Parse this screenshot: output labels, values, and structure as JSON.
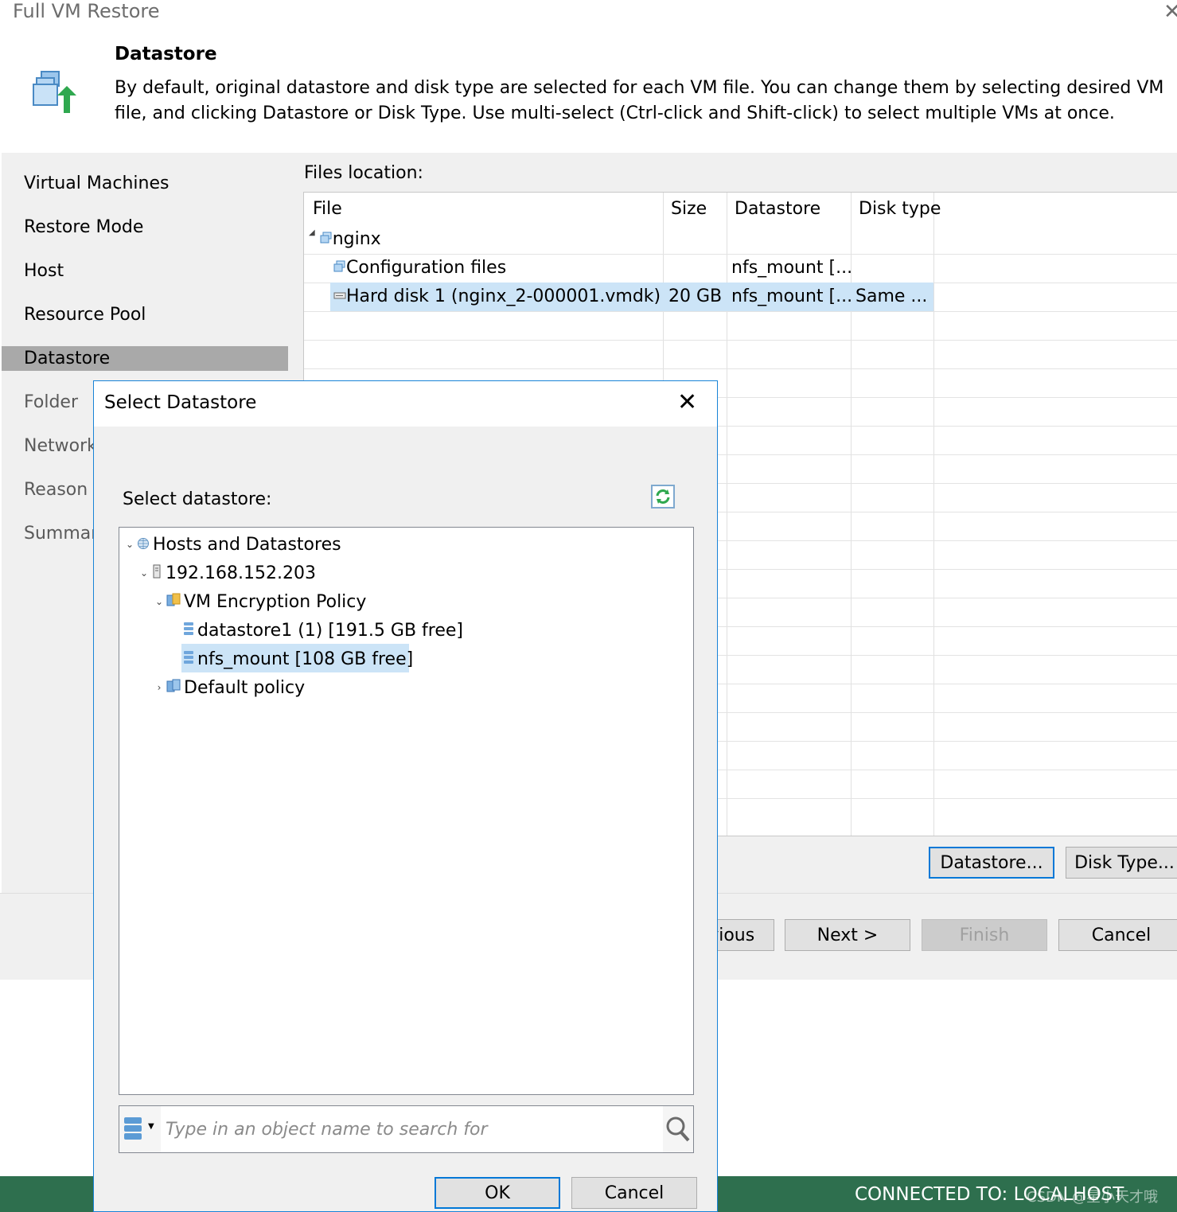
{
  "window": {
    "title": "Full VM Restore",
    "close_glyph": "✕"
  },
  "header": {
    "step_title": "Datastore",
    "description": "By default, original datastore and disk type are selected for each VM file. You can change them by selecting desired VM file, and clicking Datastore or Disk Type. Use multi-select (Ctrl-click and Shift-click) to select multiple VMs at once.",
    "icon": "vm-restore-icon"
  },
  "nav": {
    "items": [
      "Virtual Machines",
      "Restore Mode",
      "Host",
      "Resource Pool",
      "Datastore",
      "Folder",
      "Network",
      "Reason",
      "Summary"
    ],
    "selected": "Datastore"
  },
  "files": {
    "label": "Files location:",
    "columns": [
      "File",
      "Size",
      "Datastore",
      "Disk type"
    ],
    "rows": [
      {
        "file": "nginx",
        "size": "",
        "datastore": "",
        "disk_type": "",
        "icon": "vm-icon"
      },
      {
        "file": "Configuration files",
        "size": "",
        "datastore": "nfs_mount [...",
        "disk_type": "",
        "icon": "config-files-icon"
      },
      {
        "file": "Hard disk 1 (nginx_2-000001.vmdk)",
        "size": "20 GB",
        "datastore": "nfs_mount [...",
        "disk_type": "Same ...",
        "icon": "hard-disk-icon",
        "selected": true
      }
    ],
    "datastore_button": "Datastore...",
    "disk_type_button": "Disk Type..."
  },
  "footer": {
    "previous": "< Previous",
    "next": "Next >",
    "finish": "Finish",
    "cancel": "Cancel"
  },
  "dialog": {
    "title": "Select Datastore",
    "close_glyph": "✕",
    "select_label": "Select datastore:",
    "tree": {
      "root": "Hosts and Datastores",
      "host": "192.168.152.203",
      "policy": "VM Encryption Policy",
      "datastores": [
        "datastore1 (1) [191.5 GB free]",
        "nfs_mount [108 GB free]"
      ],
      "selected": "nfs_mount [108 GB free]",
      "other_policy": "Default policy"
    },
    "search_placeholder": "Type in an object name to search for",
    "ok": "OK",
    "cancel": "Cancel"
  },
  "status": {
    "text": "CONNECTED TO: LOCALHOST",
    "watermark": "CSDN @星小天才哦"
  },
  "colors": {
    "selection": "#cce4f7",
    "nav_selected": "#a9a9a9",
    "accent": "#0078d7",
    "status_bar": "#2e6f4e"
  }
}
